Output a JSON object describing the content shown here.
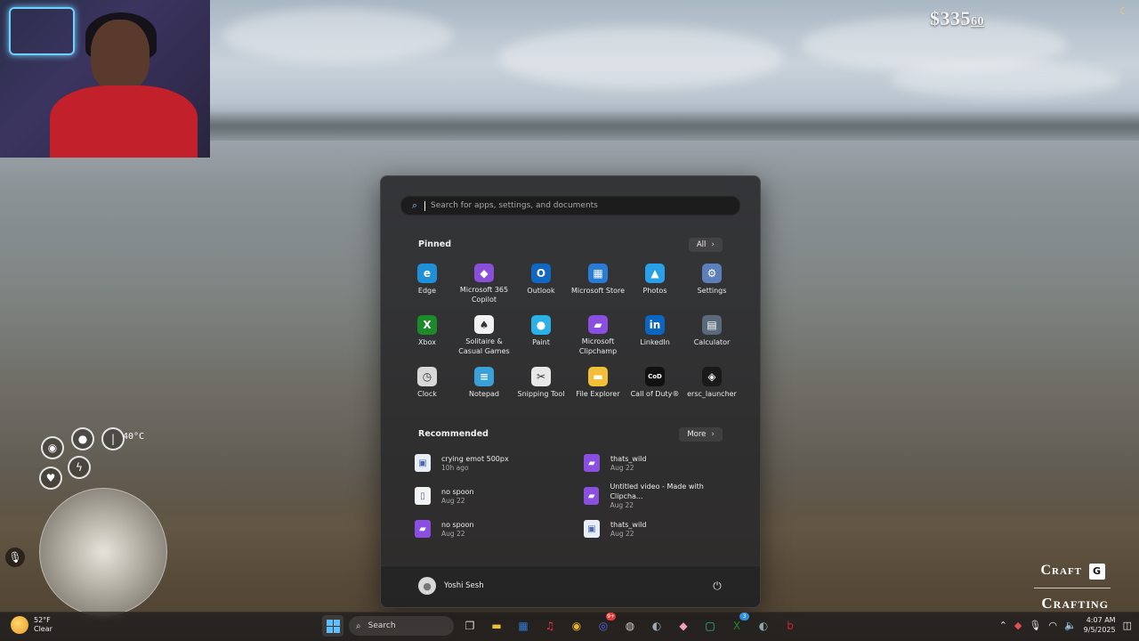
{
  "hud": {
    "money_dollars": "$335",
    "money_cents": "60",
    "temperature": "40°C",
    "craft_label": "Craft",
    "craft_key": "G",
    "crafting_label": "Crafting"
  },
  "start_menu": {
    "search_placeholder": "Search for apps, settings, and documents",
    "pinned_title": "Pinned",
    "all_label": "All",
    "pinned": [
      {
        "label": "Edge",
        "icon": "edge-icon",
        "glyph": "e",
        "color": "#1f8fd8"
      },
      {
        "label": "Microsoft 365 Copilot",
        "icon": "m365-copilot-icon",
        "glyph": "◆",
        "color": "#8a4fd8"
      },
      {
        "label": "Outlook",
        "icon": "outlook-icon",
        "glyph": "O",
        "color": "#1167c2"
      },
      {
        "label": "Microsoft Store",
        "icon": "store-icon",
        "glyph": "▦",
        "color": "#2a7bd6"
      },
      {
        "label": "Photos",
        "icon": "photos-icon",
        "glyph": "▲",
        "color": "#2aa0e8"
      },
      {
        "label": "Settings",
        "icon": "settings-icon",
        "glyph": "⚙",
        "color": "#5b7fb8"
      },
      {
        "label": "Xbox",
        "icon": "xbox-icon",
        "glyph": "X",
        "color": "#1c8a2a"
      },
      {
        "label": "Solitaire & Casual Games",
        "icon": "solitaire-icon",
        "glyph": "♠",
        "color": "#f2f2f2"
      },
      {
        "label": "Paint",
        "icon": "paint-icon",
        "glyph": "●",
        "color": "#2bb0e8"
      },
      {
        "label": "Microsoft Clipchamp",
        "icon": "clipchamp-icon",
        "glyph": "▰",
        "color": "#8a4fe0"
      },
      {
        "label": "LinkedIn",
        "icon": "linkedin-icon",
        "glyph": "in",
        "color": "#0a66c2"
      },
      {
        "label": "Calculator",
        "icon": "calculator-icon",
        "glyph": "▤",
        "color": "#5a6a7a"
      },
      {
        "label": "Clock",
        "icon": "clock-icon",
        "glyph": "◷",
        "color": "#d8d8d8"
      },
      {
        "label": "Notepad",
        "icon": "notepad-icon",
        "glyph": "≡",
        "color": "#3aa0d8"
      },
      {
        "label": "Snipping Tool",
        "icon": "snipping-tool-icon",
        "glyph": "✂",
        "color": "#e8e8e8"
      },
      {
        "label": "File Explorer",
        "icon": "file-explorer-icon",
        "glyph": "▬",
        "color": "#f2c038"
      },
      {
        "label": "Call of Duty®",
        "icon": "call-of-duty-icon",
        "glyph": "CoD",
        "color": "#111111"
      },
      {
        "label": "ersc_launcher",
        "icon": "ersc-launcher-icon",
        "glyph": "◈",
        "color": "#1a1a1a"
      }
    ],
    "recommended_title": "Recommended",
    "more_label": "More",
    "recommended": [
      {
        "title": "crying emot 500px",
        "sub": "10h ago",
        "icon": "image-file-icon",
        "glyph": "▣",
        "color": "#e8eef8"
      },
      {
        "title": "thats_wild",
        "sub": "Aug 22",
        "icon": "clipchamp-file-icon",
        "glyph": "▰",
        "color": "#8a4fe0"
      },
      {
        "title": "no spoon",
        "sub": "Aug 22",
        "icon": "document-file-icon",
        "glyph": "▯",
        "color": "#f2f2f2"
      },
      {
        "title": "Untitled video - Made with Clipcha...",
        "sub": "Aug 22",
        "icon": "clipchamp-file-icon",
        "glyph": "▰",
        "color": "#8a4fe0"
      },
      {
        "title": "no spoon",
        "sub": "Aug 22",
        "icon": "clipchamp-file-icon",
        "glyph": "▰",
        "color": "#8a4fe0"
      },
      {
        "title": "thats_wild",
        "sub": "Aug 22",
        "icon": "image-file-icon",
        "glyph": "▣",
        "color": "#e8eef8"
      }
    ],
    "user_name": "Yoshi Sesh"
  },
  "taskbar": {
    "weather_temp": "52°F",
    "weather_desc": "Clear",
    "search_label": "Search",
    "apps": [
      {
        "name": "task-view-icon",
        "glyph": "❐",
        "color": "#ddd"
      },
      {
        "name": "file-explorer-icon",
        "glyph": "▬",
        "color": "#f2c038"
      },
      {
        "name": "microsoft-store-icon",
        "glyph": "▦",
        "color": "#2a7bd6"
      },
      {
        "name": "apple-music-icon",
        "glyph": "♫",
        "color": "#fa2d48"
      },
      {
        "name": "chrome-icon",
        "glyph": "◉",
        "color": "#e8b32a"
      },
      {
        "name": "discord-icon",
        "glyph": "◎",
        "color": "#5865f2",
        "badge": "9+"
      },
      {
        "name": "obs-icon",
        "glyph": "◍",
        "color": "#cfcfcf"
      },
      {
        "name": "steam-icon",
        "glyph": "◐",
        "color": "#9ab"
      },
      {
        "name": "pink-app-icon",
        "glyph": "◆",
        "color": "#f0a0c0"
      },
      {
        "name": "chat-app-icon",
        "glyph": "▢",
        "color": "#2ec4a0"
      },
      {
        "name": "xbox-icon",
        "glyph": "X",
        "color": "#1c8a2a",
        "badge": "3"
      },
      {
        "name": "steam-alt-icon",
        "glyph": "◐",
        "color": "#8aa"
      },
      {
        "name": "launcher-icon",
        "glyph": "b",
        "color": "#d02030"
      }
    ],
    "time": "4:07 AM",
    "date": "9/5/2025"
  }
}
